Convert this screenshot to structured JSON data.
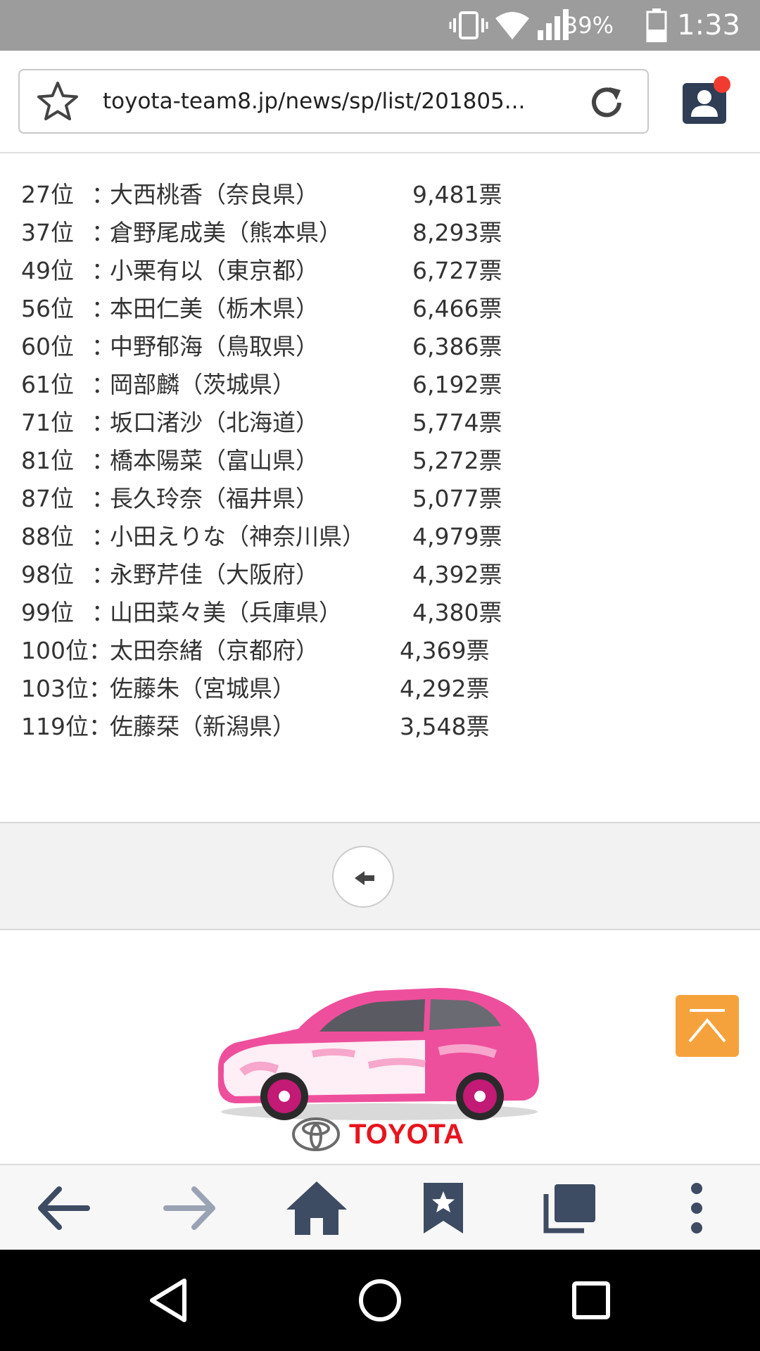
{
  "status_bar": {
    "battery_percent": "39%",
    "time": "1:33",
    "icons": [
      "vibrate-icon",
      "wifi-icon",
      "signal-icon",
      "battery-icon"
    ]
  },
  "browser": {
    "url": "toyota-team8.jp/news/sp/list/201805...",
    "icons": [
      "star-icon",
      "reload-icon",
      "profile-icon"
    ],
    "notification_color": "#f23b30"
  },
  "ranking": {
    "rows": [
      {
        "rank": "27位",
        "sep": "：",
        "member": "大西桃香（奈良県）",
        "votes": "9,481票"
      },
      {
        "rank": "37位",
        "sep": "：",
        "member": "倉野尾成美（熊本県）",
        "votes": "8,293票"
      },
      {
        "rank": "49位",
        "sep": "：",
        "member": "小栗有以（東京都）",
        "votes": "6,727票"
      },
      {
        "rank": "56位",
        "sep": "：",
        "member": "本田仁美（栃木県）",
        "votes": "6,466票"
      },
      {
        "rank": "60位",
        "sep": "：",
        "member": "中野郁海（鳥取県）",
        "votes": "6,386票"
      },
      {
        "rank": "61位",
        "sep": "：",
        "member": "岡部麟（茨城県）",
        "votes": "6,192票"
      },
      {
        "rank": "71位",
        "sep": "：",
        "member": "坂口渚沙（北海道）",
        "votes": "5,774票"
      },
      {
        "rank": "81位",
        "sep": "：",
        "member": "橋本陽菜（富山県）",
        "votes": "5,272票"
      },
      {
        "rank": "87位",
        "sep": "：",
        "member": "長久玲奈（福井県）",
        "votes": "5,077票"
      },
      {
        "rank": "88位",
        "sep": "：",
        "member": "小田えりな（神奈川県）",
        "votes": "4,979票"
      },
      {
        "rank": "98位",
        "sep": "：",
        "member": "永野芹佳（大阪府）",
        "votes": "4,392票"
      },
      {
        "rank": "99位",
        "sep": "：",
        "member": "山田菜々美（兵庫県）",
        "votes": "4,380票"
      },
      {
        "rank": "100位",
        "sep": "：",
        "member": "太田奈緒（京都府）",
        "votes": "4,369票"
      },
      {
        "rank": "103位",
        "sep": "：",
        "member": "佐藤朱（宮城県）",
        "votes": "4,292票"
      },
      {
        "rank": "119位",
        "sep": "：",
        "member": "佐藤栞（新潟県）",
        "votes": "3,548票"
      }
    ]
  },
  "pager": {
    "back_icon": "arrow-left-icon"
  },
  "footer": {
    "brand": "TOYOTA",
    "brand_color": "#e8141e",
    "car_colors": {
      "body": "#ee4f9c",
      "light": "#f7a6cc",
      "accent": "#c21a75"
    },
    "page_top_color": "#f6a23c"
  },
  "toolbar": {
    "icons": [
      "back-icon",
      "forward-icon",
      "home-icon",
      "bookmark-icon",
      "tabs-icon",
      "more-icon"
    ],
    "active_color": "#3d4b63",
    "disabled_color": "#9aa3b4"
  },
  "navbar": {
    "icons": [
      "nav-back-icon",
      "nav-home-icon",
      "nav-recents-icon"
    ]
  }
}
